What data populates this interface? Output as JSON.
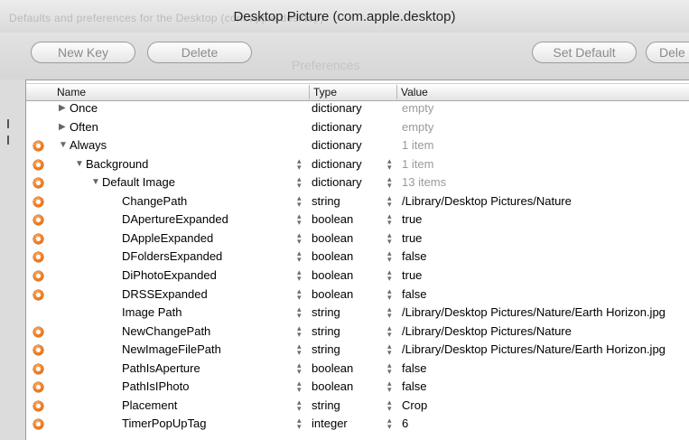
{
  "window": {
    "title": "Desktop Picture (com.apple.desktop)"
  },
  "toolbar": {
    "new_key_label": "New Key",
    "delete_label": "Delete",
    "set_default_label": "Set Default",
    "delete_right_label": "Dele"
  },
  "background": {
    "ghost_text": "Defaults and preferences for the Desktop (com.apple.desktop)",
    "ghost_label": "Preferences"
  },
  "table": {
    "columns": [
      "Name",
      "Type",
      "Value"
    ],
    "rows": [
      {
        "name": "Once",
        "type": "dictionary",
        "value": "empty",
        "depth": 0,
        "disclosure": "collapsed",
        "badge": false,
        "steppers": false,
        "value_muted": true
      },
      {
        "name": "Often",
        "type": "dictionary",
        "value": "empty",
        "depth": 0,
        "disclosure": "collapsed",
        "badge": false,
        "steppers": false,
        "value_muted": true
      },
      {
        "name": "Always",
        "type": "dictionary",
        "value": "1 item",
        "depth": 0,
        "disclosure": "expanded",
        "badge": true,
        "steppers": false,
        "value_muted": true
      },
      {
        "name": "Background",
        "type": "dictionary",
        "value": "1 item",
        "depth": 1,
        "disclosure": "expanded",
        "badge": true,
        "steppers": true,
        "value_muted": true
      },
      {
        "name": "Default Image",
        "type": "dictionary",
        "value": "13 items",
        "depth": 2,
        "disclosure": "expanded",
        "badge": true,
        "steppers": true,
        "value_muted": true
      },
      {
        "name": "ChangePath",
        "type": "string",
        "value": "/Library/Desktop Pictures/Nature",
        "depth": 3,
        "disclosure": "none",
        "badge": true,
        "steppers": true,
        "value_muted": false
      },
      {
        "name": "DApertureExpanded",
        "type": "boolean",
        "value": "true",
        "depth": 3,
        "disclosure": "none",
        "badge": true,
        "steppers": true,
        "value_muted": false
      },
      {
        "name": "DAppleExpanded",
        "type": "boolean",
        "value": "true",
        "depth": 3,
        "disclosure": "none",
        "badge": true,
        "steppers": true,
        "value_muted": false
      },
      {
        "name": "DFoldersExpanded",
        "type": "boolean",
        "value": "false",
        "depth": 3,
        "disclosure": "none",
        "badge": true,
        "steppers": true,
        "value_muted": false
      },
      {
        "name": "DiPhotoExpanded",
        "type": "boolean",
        "value": "true",
        "depth": 3,
        "disclosure": "none",
        "badge": true,
        "steppers": true,
        "value_muted": false
      },
      {
        "name": "DRSSExpanded",
        "type": "boolean",
        "value": "false",
        "depth": 3,
        "disclosure": "none",
        "badge": true,
        "steppers": true,
        "value_muted": false
      },
      {
        "name": "Image Path",
        "type": "string",
        "value": "/Library/Desktop Pictures/Nature/Earth Horizon.jpg",
        "depth": 3,
        "disclosure": "none",
        "badge": false,
        "steppers": true,
        "value_muted": false
      },
      {
        "name": "NewChangePath",
        "type": "string",
        "value": "/Library/Desktop Pictures/Nature",
        "depth": 3,
        "disclosure": "none",
        "badge": true,
        "steppers": true,
        "value_muted": false
      },
      {
        "name": "NewImageFilePath",
        "type": "string",
        "value": "/Library/Desktop Pictures/Nature/Earth Horizon.jpg",
        "depth": 3,
        "disclosure": "none",
        "badge": true,
        "steppers": true,
        "value_muted": false
      },
      {
        "name": "PathIsAperture",
        "type": "boolean",
        "value": "false",
        "depth": 3,
        "disclosure": "none",
        "badge": true,
        "steppers": true,
        "value_muted": false
      },
      {
        "name": "PathIsIPhoto",
        "type": "boolean",
        "value": "false",
        "depth": 3,
        "disclosure": "none",
        "badge": true,
        "steppers": true,
        "value_muted": false
      },
      {
        "name": "Placement",
        "type": "string",
        "value": "Crop",
        "depth": 3,
        "disclosure": "none",
        "badge": true,
        "steppers": true,
        "value_muted": false
      },
      {
        "name": "TimerPopUpTag",
        "type": "integer",
        "value": "6",
        "depth": 3,
        "disclosure": "none",
        "badge": true,
        "steppers": true,
        "value_muted": false
      }
    ]
  },
  "icons": {
    "badge": "modified-badge-icon",
    "disclosure_collapsed": "disclosure-right-icon",
    "disclosure_expanded": "disclosure-down-icon",
    "stepper": "stepper-icon"
  },
  "colors": {
    "badge": "#f0700f",
    "muted_text": "#9a9a9a"
  }
}
